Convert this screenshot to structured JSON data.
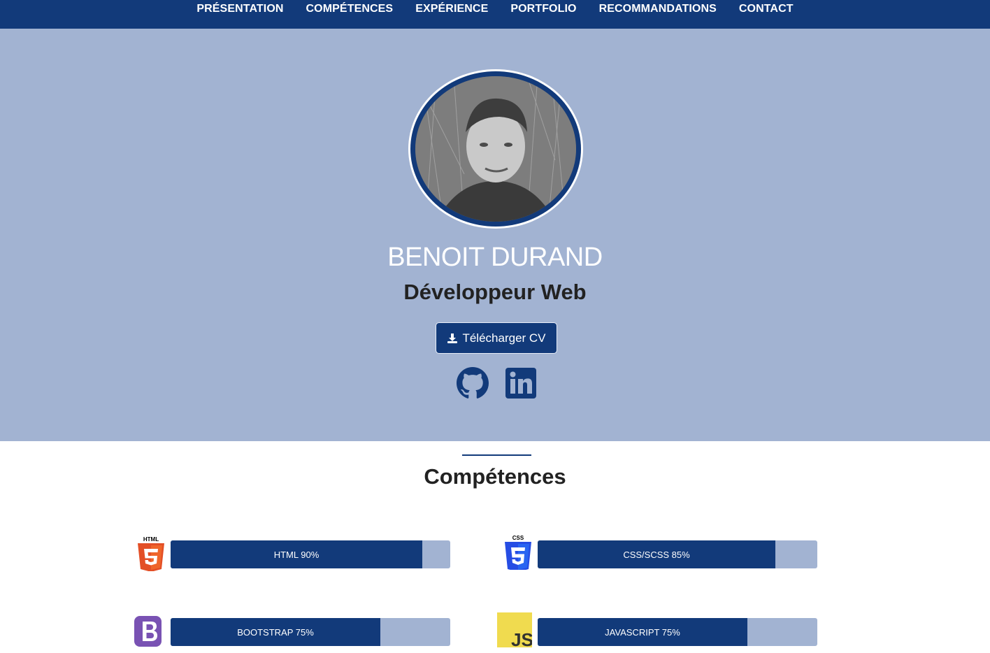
{
  "nav": {
    "items": [
      "PRÉSENTATION",
      "COMPÉTENCES",
      "EXPÉRIENCE",
      "PORTFOLIO",
      "RECOMMANDATIONS",
      "CONTACT"
    ]
  },
  "hero": {
    "name": "BENOIT DURAND",
    "role": "Développeur Web",
    "cv_button": "Télécharger CV",
    "social": [
      "github-icon",
      "linkedin-icon"
    ]
  },
  "skills_section": {
    "title": "Compétences",
    "skills": [
      {
        "label": "HTML 90%",
        "level": 0.9,
        "icon": "html5-icon",
        "color": "#e34f26"
      },
      {
        "label": "CSS/SCSS 85%",
        "level": 0.85,
        "icon": "css3-icon",
        "color": "#264de4"
      },
      {
        "label": "BOOTSTRAP 75%",
        "level": 0.75,
        "icon": "bootstrap-icon",
        "color": "#7952b3"
      },
      {
        "label": "JAVASCRIPT 75%",
        "level": 0.75,
        "icon": "javascript-icon",
        "color": "#f0db4f"
      }
    ]
  },
  "colors": {
    "primary": "#123a7a",
    "hero_bg": "#a2b3d2"
  }
}
